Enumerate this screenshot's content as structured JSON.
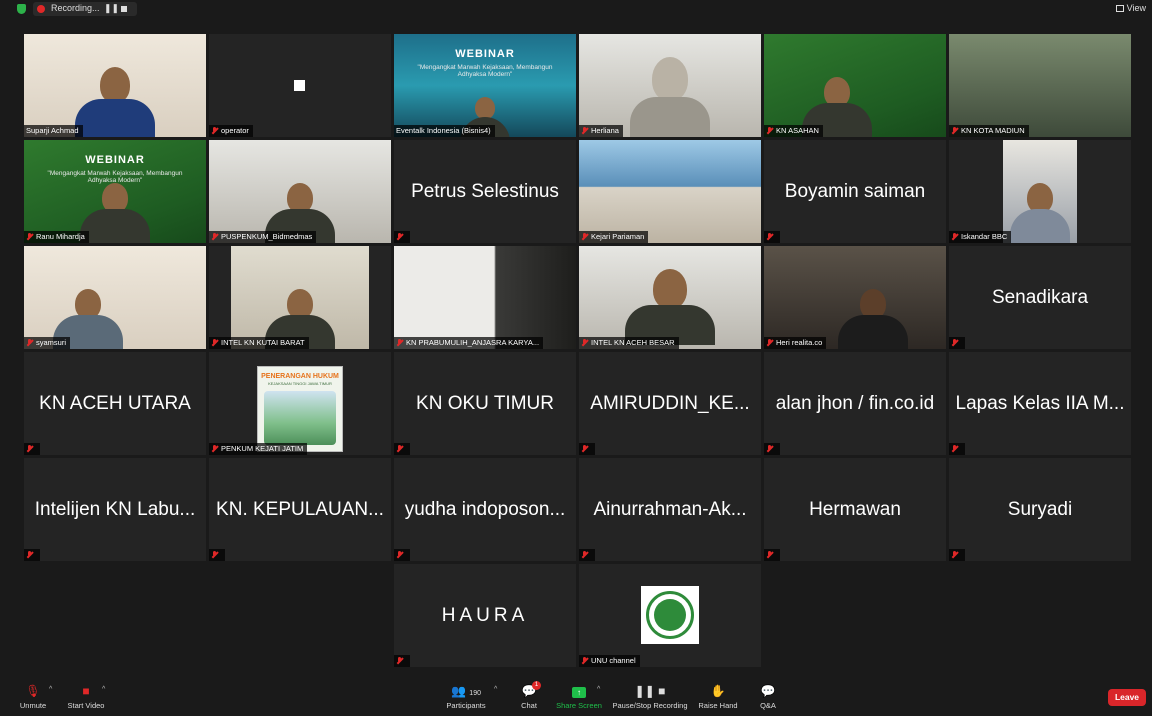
{
  "top_bar": {
    "recording_label": "Recording...",
    "pause_glyph": "❚❚",
    "view_label": "View"
  },
  "tiles": [
    {
      "name": "Suparji Achmad",
      "kind": "video",
      "active": true
    },
    {
      "name": "operator",
      "kind": "video"
    },
    {
      "name": "Eventalk Indonesia (Bisnis4)",
      "kind": "video"
    },
    {
      "name": "Herliana",
      "kind": "video"
    },
    {
      "name": "KN ASAHAN",
      "kind": "video"
    },
    {
      "name": "KN KOTA MADIUN",
      "kind": "video"
    },
    {
      "name": "Ranu Mihardja",
      "kind": "video"
    },
    {
      "name": "PUSPENKUM_Bidmedmas",
      "kind": "video"
    },
    {
      "name": "Petrus Selestinus",
      "kind": "name"
    },
    {
      "name": "Kejari Pariaman",
      "kind": "video"
    },
    {
      "name": "Boyamin saiman",
      "kind": "name"
    },
    {
      "name": "Iskandar BBC",
      "kind": "video"
    },
    {
      "name": "syamsuri",
      "kind": "video"
    },
    {
      "name": "INTEL KN KUTAI BARAT",
      "kind": "video"
    },
    {
      "name": "KN PRABUMULIH_ANJASRA KARYA...",
      "kind": "video"
    },
    {
      "name": "INTEL KN ACEH BESAR",
      "kind": "video"
    },
    {
      "name": "Heri realita.co",
      "kind": "video"
    },
    {
      "name": "Senadikara",
      "kind": "name"
    },
    {
      "name": "KN ACEH UTARA",
      "kind": "name"
    },
    {
      "name": "PENKUM KEJATI JATIM",
      "kind": "video"
    },
    {
      "name": "KN OKU TIMUR",
      "kind": "name"
    },
    {
      "name": "AMIRUDDIN_KE...",
      "kind": "name"
    },
    {
      "name": "alan jhon / fin.co.id",
      "kind": "name"
    },
    {
      "name": "Lapas Kelas IIA M...",
      "kind": "name"
    },
    {
      "name": "Intelijen KN Labu...",
      "kind": "name"
    },
    {
      "name": "KN. KEPULAUAN...",
      "kind": "name"
    },
    {
      "name": "yudha indoposon...",
      "kind": "name"
    },
    {
      "name": "Ainurrahman-Ak...",
      "kind": "name"
    },
    {
      "name": "Hermawan",
      "kind": "name"
    },
    {
      "name": "Suryadi",
      "kind": "name"
    },
    {
      "name": "HAURA",
      "kind": "name"
    },
    {
      "name": "UNU channel",
      "kind": "video"
    }
  ],
  "video_text": {
    "webinar": "WEBINAR",
    "webinar_sub": "\"Mengangkat Marwah Kejaksaan, Membangun Adhyaksa Modern\"",
    "poster_title": "PENERANGAN HUKUM",
    "poster_sub": "KEJAKSAAN TINGGI JAWA TIMUR"
  },
  "toolbar": {
    "unmute": "Unmute",
    "start_video": "Start Video",
    "participants": "Participants",
    "participants_count": "190",
    "chat": "Chat",
    "chat_badge": "1",
    "share_screen": "Share Screen",
    "pause_stop_recording": "Pause/Stop Recording",
    "raise_hand": "Raise Hand",
    "qa": "Q&A",
    "leave": "Leave"
  },
  "colors": {
    "active_speaker_border": "#c8e62a",
    "share_green": "#1fbf4a",
    "leave_red": "#d9262a",
    "muted_red": "#e02828"
  }
}
